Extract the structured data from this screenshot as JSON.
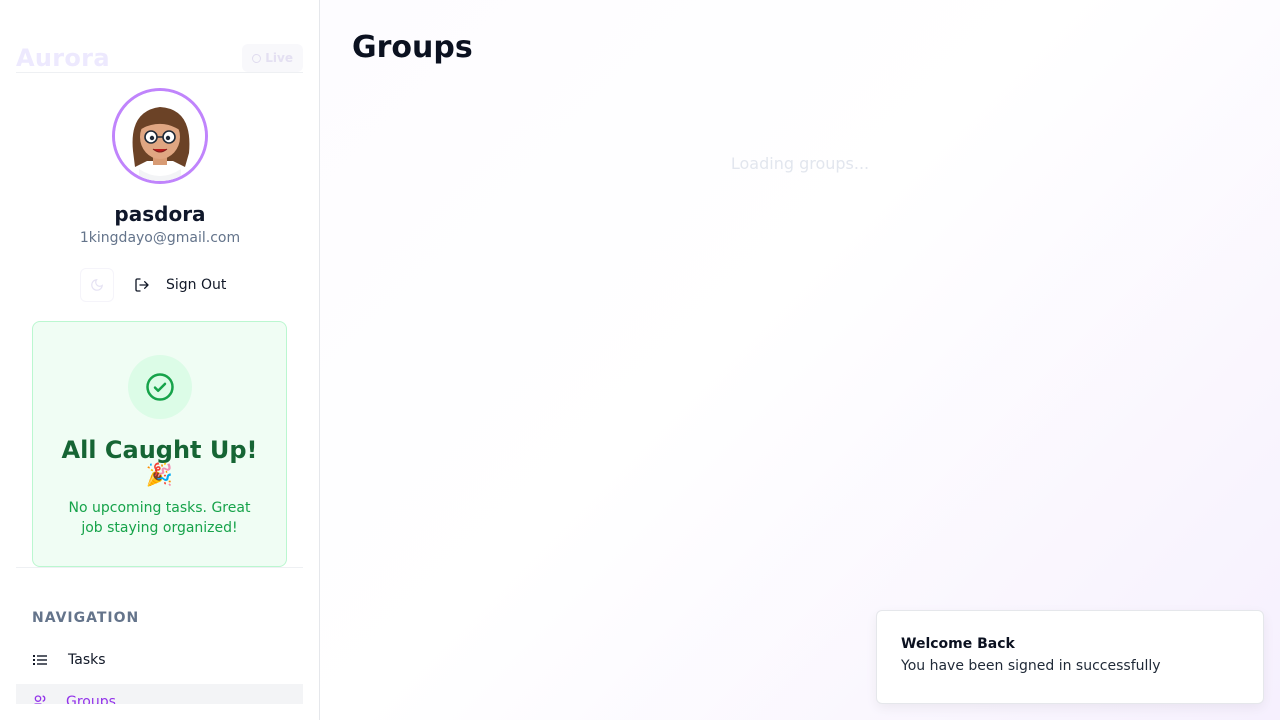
{
  "sidebar": {
    "brand": "Aurora",
    "live_badge": "Live",
    "profile": {
      "username": "pasdora",
      "email": "1kingdayo@gmail.com"
    },
    "actions": {
      "sign_out_label": "Sign Out"
    },
    "status_card": {
      "title": "All Caught Up!",
      "emoji": "🎉",
      "message": "No upcoming tasks. Great job staying organized!"
    },
    "navigation": {
      "heading": "NAVIGATION",
      "items": [
        {
          "label": "Tasks",
          "icon": "list-icon"
        },
        {
          "label": "Groups",
          "icon": "users-icon",
          "active": true
        }
      ]
    }
  },
  "main": {
    "title": "Groups",
    "loading_text": "Loading groups..."
  },
  "toast": {
    "title": "Welcome Back",
    "message": "You have been signed in successfully"
  },
  "colors": {
    "accent": "#9333ea",
    "avatar_ring": "#c084fc",
    "success": "#16a34a",
    "success_dark": "#166534",
    "success_bg": "#f0fdf4"
  }
}
